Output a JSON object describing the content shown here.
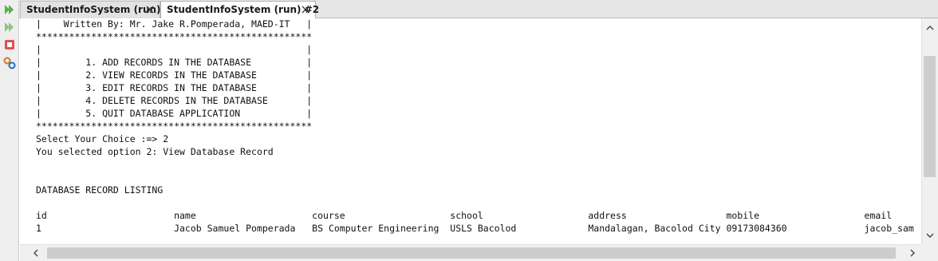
{
  "tabs": [
    {
      "label": "StudentInfoSystem (run)",
      "active": false
    },
    {
      "label": "StudentInfoSystem (run) #2",
      "active": true
    }
  ],
  "toolbar": {
    "icons": [
      "rerun-icon",
      "rerun-with-args-icon",
      "stop-icon",
      "settings-icon"
    ]
  },
  "console": {
    "lines": [
      "|    Written By: Mr. Jake R.Pomperada, MAED-IT   |",
      "**************************************************",
      "|                                                |",
      "|        1. ADD RECORDS IN THE DATABASE          |",
      "|        2. VIEW RECORDS IN THE DATABASE         |",
      "|        3. EDIT RECORDS IN THE DATABASE         |",
      "|        4. DELETE RECORDS IN THE DATABASE       |",
      "|        5. QUIT DATABASE APPLICATION            |",
      "**************************************************",
      "Select Your Choice :=> 2",
      "You selected option 2: View Database Record",
      "",
      "",
      "DATABASE RECORD LISTING",
      "",
      "id                       name                     course                   school                   address                  mobile                   email",
      "1                        Jacob Samuel Pomperada   BS Computer Engineering  USLS Bacolod             Mandalagan, Bacolod City 09173084360              jacob_sam"
    ]
  },
  "colors": {
    "run_green": "#5cae4e",
    "stop_red": "#d9534f"
  }
}
